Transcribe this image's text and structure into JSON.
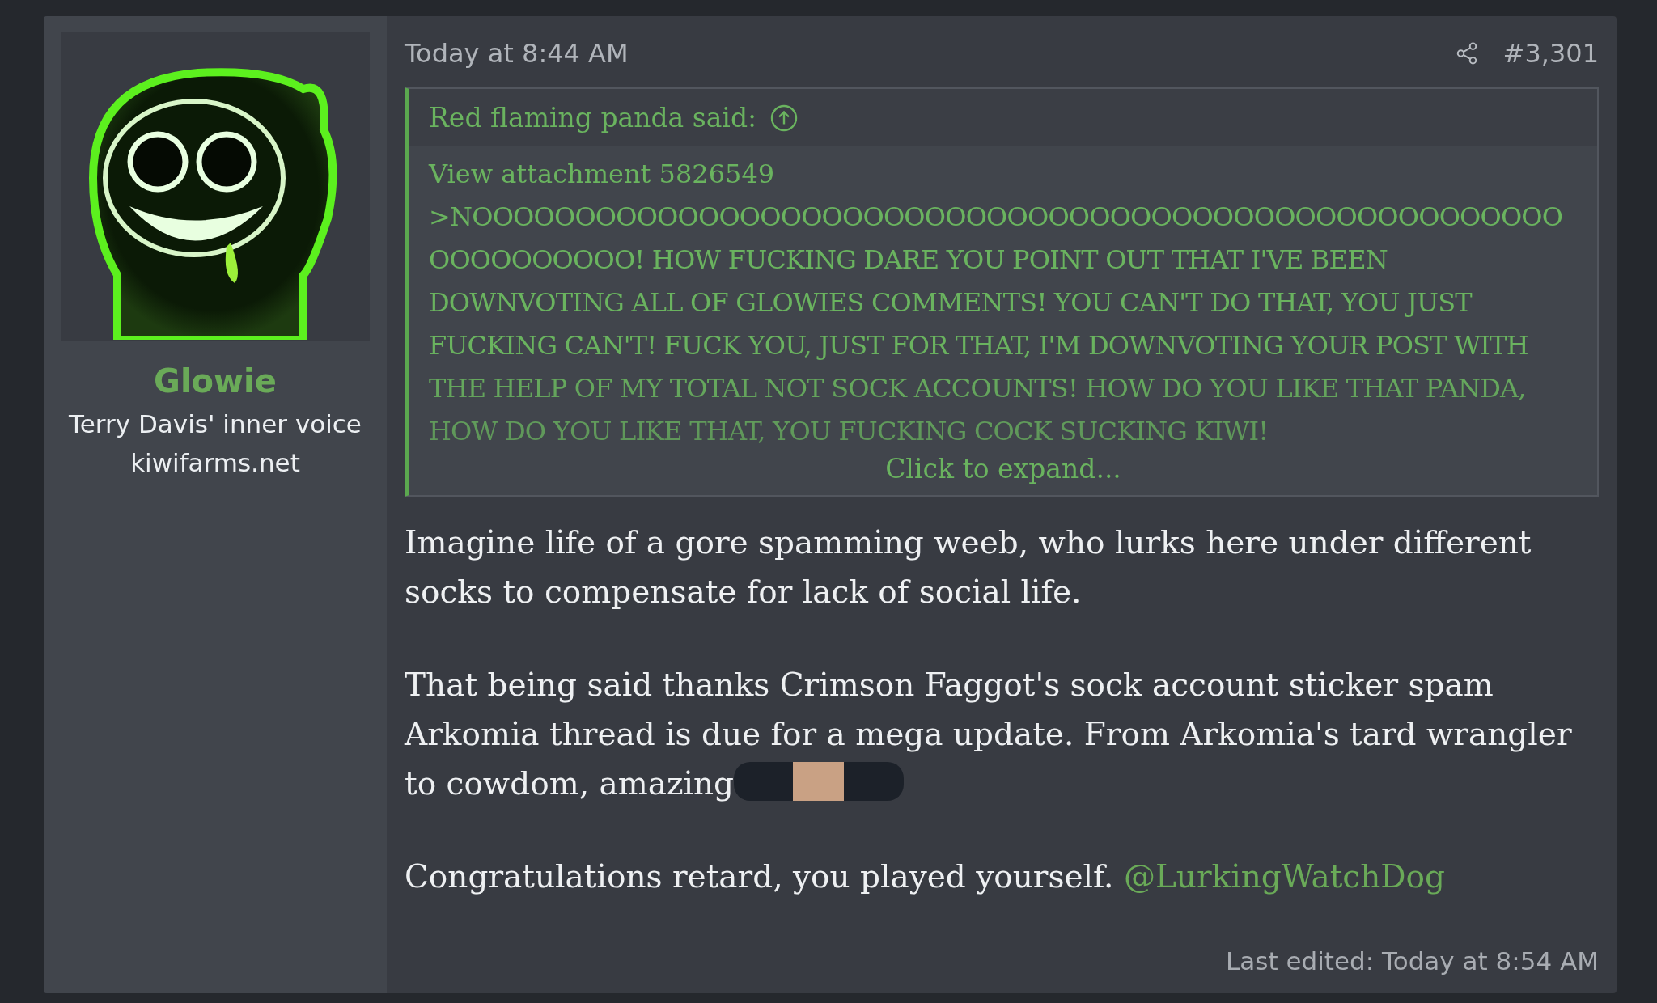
{
  "author": {
    "name": "Glowie",
    "title": "Terry Davis' inner voice",
    "site": "kiwifarms.net"
  },
  "post": {
    "date": "Today at 8:44 AM",
    "number": "#3,301"
  },
  "quote": {
    "attribution": "Red flaming panda said:",
    "attachment": "View attachment 5826549",
    "text": ">NOOOOOOOOOOOOOOOOOOOOOOOOOOOOOOOOOOOOOOOOOOOOOOOOOOOOOOOOOOOOOOO! HOW FUCKING DARE YOU POINT OUT THAT I'VE BEEN DOWNVOTING ALL OF GLOWIES COMMENTS! YOU CAN'T DO THAT, YOU JUST FUCKING CAN'T! FUCK YOU, JUST FOR THAT, I'M DOWNVOTING YOUR POST WITH THE HELP OF MY TOTAL NOT SOCK ACCOUNTS! HOW DO YOU LIKE THAT PANDA, HOW DO YOU LIKE THAT, YOU FUCKING COCK SUCKING KIWI!",
    "expand": "Click to expand..."
  },
  "body": [
    {
      "kind": "plain",
      "text": "Imagine life of a gore spamming weeb, who lurks here under different socks to compensate for lack of social life."
    },
    {
      "kind": "sticker",
      "text": "That being said thanks Crimson Faggot's sock account sticker spam Arkomia thread is due for a mega update. From Arkomia's tard wrangler to cowdom, amazing"
    },
    {
      "kind": "mention",
      "text": "Congratulations retard, you played yourself. ",
      "mention": "@LurkingWatchDog"
    }
  ],
  "last_edited": "Last edited: Today at 8:54 AM"
}
